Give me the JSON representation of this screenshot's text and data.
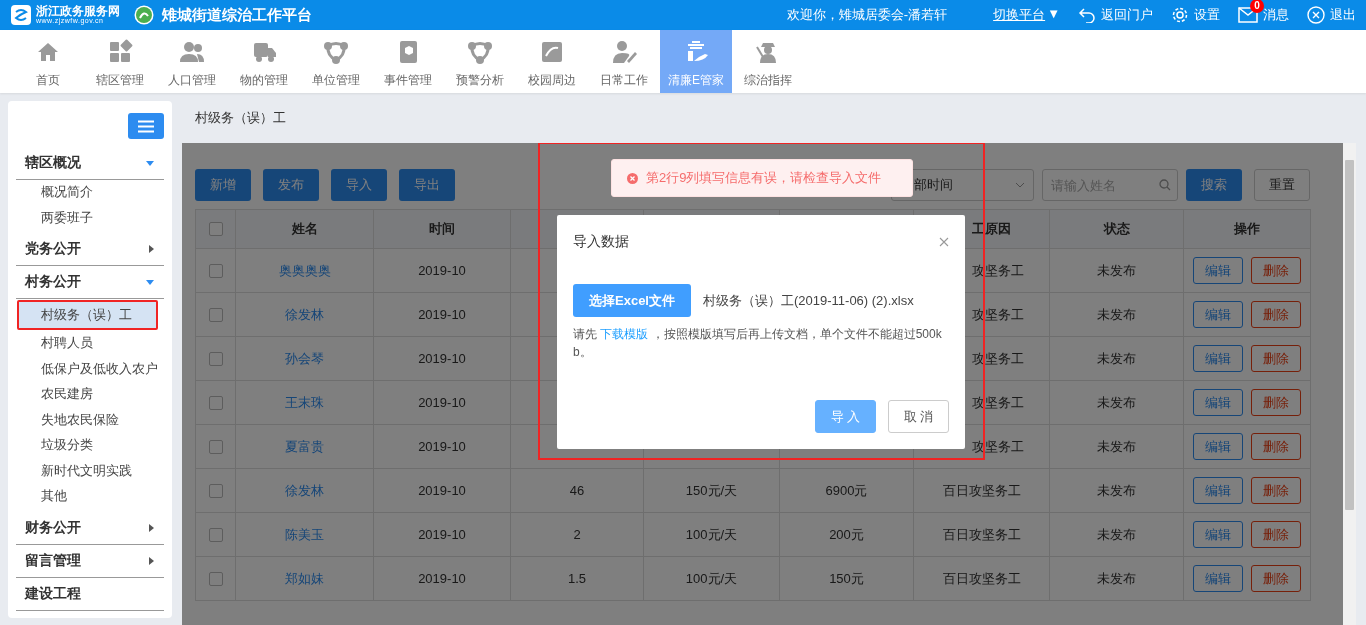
{
  "header": {
    "portal_name": "浙江政务服务网",
    "portal_url": "www.zjzwfw.gov.cn",
    "platform_title": "雉城街道综治工作平台",
    "welcome": "欢迎你，雉城居委会-潘若轩",
    "switch_platform": "切换平台",
    "switch_caret": "▼",
    "links": [
      {
        "kind": "back",
        "label": "返回门户"
      },
      {
        "kind": "settings",
        "label": "设置"
      },
      {
        "kind": "messages",
        "label": "消息",
        "badge": "0"
      },
      {
        "kind": "logout",
        "label": "退出"
      }
    ]
  },
  "nav": [
    {
      "label": "首页",
      "selected": false
    },
    {
      "label": "辖区管理",
      "selected": false
    },
    {
      "label": "人口管理",
      "selected": false
    },
    {
      "label": "物的管理",
      "selected": false
    },
    {
      "label": "单位管理",
      "selected": false
    },
    {
      "label": "事件管理",
      "selected": false
    },
    {
      "label": "预警分析",
      "selected": false
    },
    {
      "label": "校园周边",
      "selected": false
    },
    {
      "label": "日常工作",
      "selected": false
    },
    {
      "label": "清廉E管家",
      "selected": true
    },
    {
      "label": "综治指挥",
      "selected": false
    }
  ],
  "sidebar": {
    "sections": [
      {
        "kind": "group",
        "label": "辖区概况",
        "expanded": true,
        "children": [
          {
            "label": "概况简介",
            "selected": false
          },
          {
            "label": "两委班子",
            "selected": false
          }
        ]
      },
      {
        "kind": "group",
        "label": "党务公开",
        "expanded": false
      },
      {
        "kind": "group",
        "label": "村务公开",
        "expanded": true,
        "children": [
          {
            "label": "村级务（误）工",
            "selected": true
          },
          {
            "label": "村聘人员",
            "selected": false
          },
          {
            "label": "低保户及低收入农户",
            "selected": false
          },
          {
            "label": "农民建房",
            "selected": false
          },
          {
            "label": "失地农民保险",
            "selected": false
          },
          {
            "label": "垃圾分类",
            "selected": false
          },
          {
            "label": "新时代文明实践",
            "selected": false
          },
          {
            "label": "其他",
            "selected": false
          }
        ]
      },
      {
        "kind": "group",
        "label": "财务公开",
        "expanded": false
      },
      {
        "kind": "group",
        "label": "留言管理",
        "expanded": false
      },
      {
        "kind": "link",
        "label": "建设工程"
      }
    ]
  },
  "breadcrumb": "村级务（误）工",
  "toolbar": {
    "buttons": [
      "新增",
      "发布",
      "导入",
      "导出"
    ],
    "time_filter": "部时间",
    "search": {
      "placeholder": "请输入姓名"
    },
    "search_button": "搜索",
    "reset_button": "重置"
  },
  "table": {
    "header_checked": false,
    "columns": [
      {
        "kind": "checkbox"
      },
      {
        "kind": "text",
        "label": "姓名"
      },
      {
        "kind": "text",
        "label": "时间"
      },
      {
        "kind": "covered"
      },
      {
        "kind": "covered"
      },
      {
        "kind": "covered"
      },
      {
        "kind": "text",
        "label": "工原因"
      },
      {
        "kind": "text",
        "label": "状态"
      },
      {
        "kind": "text",
        "label": "操作"
      }
    ],
    "rows": [
      {
        "checked": false,
        "name": "奥奥奥奥",
        "time": "2019-10",
        "reason": "攻坚务工",
        "status": "未发布",
        "actions": [
          "编辑",
          "删除"
        ]
      },
      {
        "checked": false,
        "name": "徐发林",
        "time": "2019-10",
        "reason": "攻坚务工",
        "status": "未发布",
        "actions": [
          "编辑",
          "删除"
        ]
      },
      {
        "checked": false,
        "name": "孙会琴",
        "time": "2019-10",
        "reason": "攻坚务工",
        "status": "未发布",
        "actions": [
          "编辑",
          "删除"
        ]
      },
      {
        "checked": false,
        "name": "王末珠",
        "time": "2019-10",
        "reason": "攻坚务工",
        "status": "未发布",
        "actions": [
          "编辑",
          "删除"
        ]
      },
      {
        "checked": false,
        "name": "夏富贵",
        "time": "2019-10",
        "reason": "攻坚务工",
        "status": "未发布",
        "actions": [
          "编辑",
          "删除"
        ]
      },
      {
        "checked": false,
        "name": "徐发林",
        "time": "2019-10",
        "column_4": "46",
        "column_5": "150元/天",
        "column_6": "6900元",
        "reason": "百日攻坚务工",
        "status": "未发布",
        "actions": [
          "编辑",
          "删除"
        ]
      },
      {
        "checked": false,
        "name": "陈美玉",
        "time": "2019-10",
        "column_4": "2",
        "column_5": "100元/天",
        "column_6": "200元",
        "reason": "百日攻坚务工",
        "status": "未发布",
        "actions": [
          "编辑",
          "删除"
        ]
      },
      {
        "checked": false,
        "name": "郑如妹",
        "time": "2019-10",
        "column_4": "1.5",
        "column_5": "100元/天",
        "column_6": "150元",
        "reason": "百日攻坚务工",
        "status": "未发布",
        "actions": [
          "编辑",
          "删除"
        ]
      }
    ]
  },
  "toast": {
    "kind": "error",
    "message": "第2行9列填写信息有误，请检查导入文件"
  },
  "modal": {
    "title": "导入数据",
    "choose_button": "选择Excel文件",
    "file_name": "村级务（误）工(2019-11-06) (2).xlsx",
    "hint_before": "请先 ",
    "hint_link": "下载模版",
    "hint_after": " ，按照模版填写后再上传文档，单个文件不能超过500kb。",
    "buttons": [
      {
        "kind": "primary",
        "label": "导 入",
        "disabled": true
      },
      {
        "kind": "default",
        "label": "取 消",
        "disabled": false
      }
    ]
  }
}
